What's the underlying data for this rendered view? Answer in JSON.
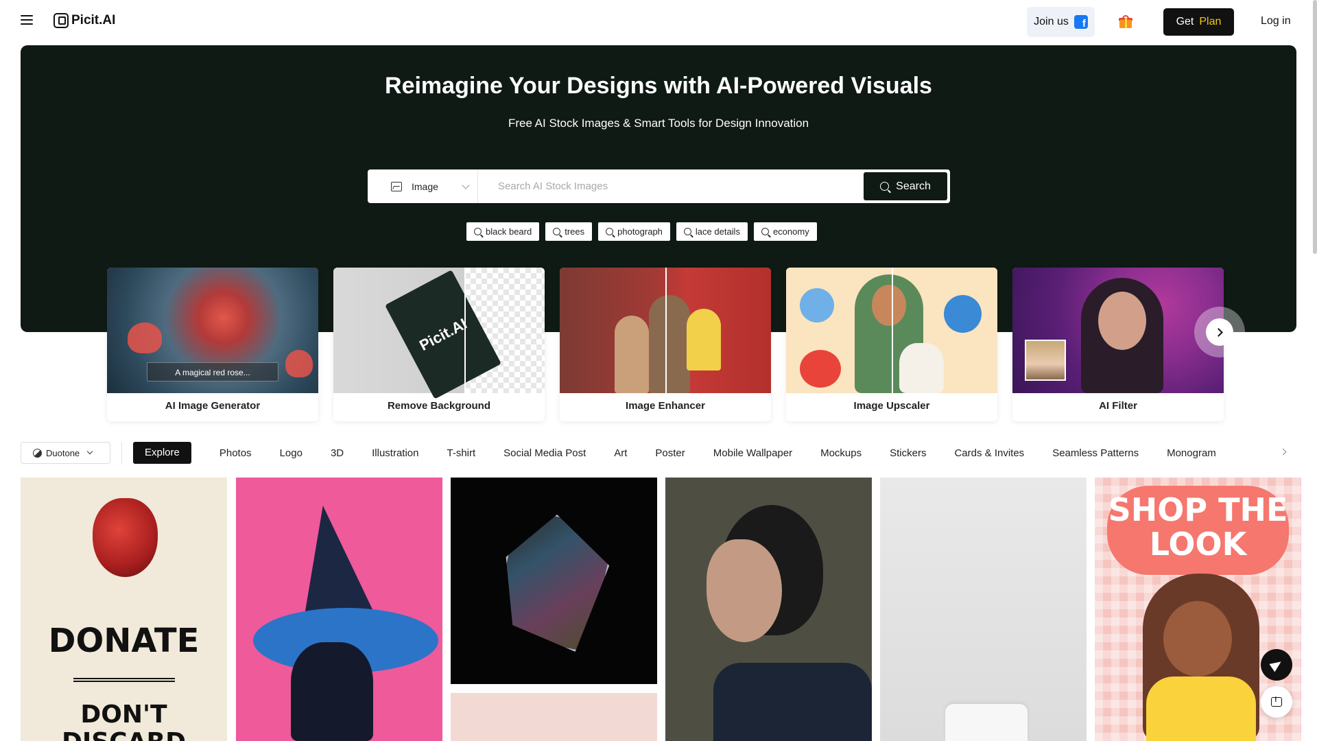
{
  "header": {
    "logo_text": "Picit.AI",
    "join_label": "Join us",
    "plan_label_1": "Get",
    "plan_label_2": "Plan",
    "login_label": "Log in"
  },
  "hero": {
    "title": "Reimagine Your Designs with AI-Powered Visuals",
    "subtitle": "Free AI Stock Images & Smart Tools for Design Innovation",
    "search": {
      "type_label": "Image",
      "placeholder": "Search AI Stock Images",
      "value": "",
      "button_label": "Search"
    },
    "chips": [
      "black beard",
      "trees",
      "photograph",
      "lace details",
      "economy"
    ]
  },
  "tools": [
    {
      "label": "AI Image Generator",
      "caption": "A magical red rose..."
    },
    {
      "label": "Remove Background",
      "caption": "Picit.AI"
    },
    {
      "label": "Image Enhancer"
    },
    {
      "label": "Image Upscaler"
    },
    {
      "label": "AI Filter"
    }
  ],
  "filters": {
    "style_label": "Duotone",
    "categories": [
      "Explore",
      "Photos",
      "Logo",
      "3D",
      "Illustration",
      "T-shirt",
      "Social Media Post",
      "Art",
      "Poster",
      "Mobile Wallpaper",
      "Mockups",
      "Stickers",
      "Cards & Invites",
      "Seamless Patterns",
      "Monogram"
    ],
    "active": "Explore"
  },
  "gallery": {
    "donate_title": "DONATE",
    "donate_sub": "DON'T DISCARD",
    "shop_title": "SHOP THE LOOK"
  },
  "colors": {
    "hero_bg": "#101a15",
    "accent_yellow": "#f5c518",
    "facebook_blue": "#1877f2"
  }
}
